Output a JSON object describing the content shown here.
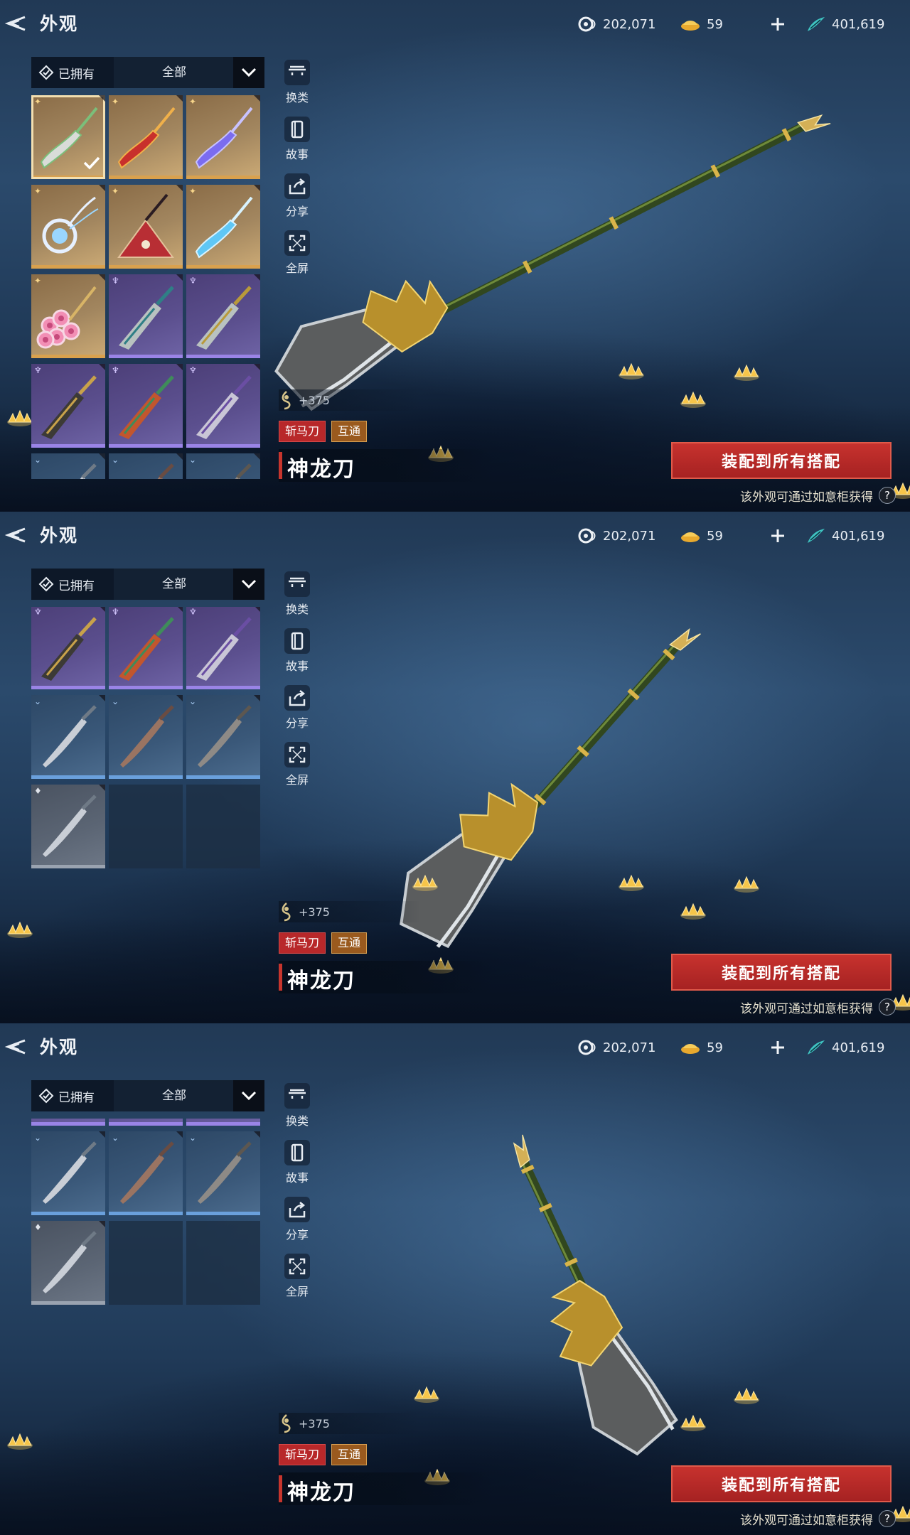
{
  "screens": [
    {
      "header": {
        "title": "外观"
      },
      "currencies": {
        "jade": "202,071",
        "ingot": "59",
        "coins": "401,619"
      },
      "filter": {
        "owned_label": "已拥有",
        "category": "全部"
      },
      "actions": {
        "swap": "换类",
        "story": "故事",
        "share": "分享",
        "fullscreen": "全屏"
      },
      "weapon": {
        "power": "+375",
        "tag_type": "斩马刀",
        "tag_share": "互通",
        "name": "神龙刀",
        "equip_label": "装配到所有搭配",
        "source_text": "该外观可通过如意柜获得"
      }
    },
    {
      "header": {
        "title": "外观"
      },
      "currencies": {
        "jade": "202,071",
        "ingot": "59",
        "coins": "401,619"
      },
      "filter": {
        "owned_label": "已拥有",
        "category": "全部"
      },
      "actions": {
        "swap": "换类",
        "story": "故事",
        "share": "分享",
        "fullscreen": "全屏"
      },
      "weapon": {
        "power": "+375",
        "tag_type": "斩马刀",
        "tag_share": "互通",
        "name": "神龙刀",
        "equip_label": "装配到所有搭配",
        "source_text": "该外观可通过如意柜获得"
      }
    },
    {
      "header": {
        "title": "外观"
      },
      "currencies": {
        "jade": "202,071",
        "ingot": "59",
        "coins": "401,619"
      },
      "filter": {
        "owned_label": "已拥有",
        "category": "全部"
      },
      "actions": {
        "swap": "换类",
        "story": "故事",
        "share": "分享",
        "fullscreen": "全屏"
      },
      "weapon": {
        "power": "+375",
        "tag_type": "斩马刀",
        "tag_share": "互通",
        "name": "神龙刀",
        "equip_label": "装配到所有搭配",
        "source_text": "该外观可通过如意柜获得"
      }
    }
  ],
  "help_glyph": "?",
  "grid": {
    "selected_index": 0,
    "tiles": [
      {
        "rarity": "gold",
        "kind": "glaive",
        "color": "#d9dcd8",
        "accent": "#7bbf7a"
      },
      {
        "rarity": "gold",
        "kind": "glaive",
        "color": "#c8302c",
        "accent": "#f0b04a"
      },
      {
        "rarity": "gold",
        "kind": "glaive",
        "color": "#7b6cf0",
        "accent": "#c8c2ff"
      },
      {
        "rarity": "gold",
        "kind": "orb",
        "color": "#9ad6ff",
        "accent": "#e6f0ff"
      },
      {
        "rarity": "gold",
        "kind": "shield",
        "color": "#b82e34",
        "accent": "#2a1c22"
      },
      {
        "rarity": "gold",
        "kind": "glaive",
        "color": "#5fc7f5",
        "accent": "#d8f3ff"
      },
      {
        "rarity": "gold",
        "kind": "flower",
        "color": "#f28fb5",
        "accent": "#f7d7e4"
      },
      {
        "rarity": "purple",
        "kind": "blade",
        "color": "#b9c2c0",
        "accent": "#2f7f86"
      },
      {
        "rarity": "purple",
        "kind": "blade",
        "color": "#b9c2c0",
        "accent": "#b99a3a"
      },
      {
        "rarity": "purple",
        "kind": "blade",
        "color": "#3c3a36",
        "accent": "#c8a24a"
      },
      {
        "rarity": "purple",
        "kind": "blade",
        "color": "#c2562e",
        "accent": "#3f8c5a"
      },
      {
        "rarity": "purple",
        "kind": "blade",
        "color": "#c9c6d6",
        "accent": "#6a4ea3"
      },
      {
        "rarity": "blue",
        "kind": "sabre",
        "color": "#c9ced6",
        "accent": "#6f7a86"
      },
      {
        "rarity": "blue",
        "kind": "sabre",
        "color": "#9a7462",
        "accent": "#6a4c42"
      },
      {
        "rarity": "blue",
        "kind": "sabre",
        "color": "#8e8a86",
        "accent": "#5d5750"
      },
      {
        "rarity": "gray",
        "kind": "sabre",
        "color": "#c9ced6",
        "accent": "#6f7a86"
      },
      {
        "rarity": "empty"
      },
      {
        "rarity": "empty"
      }
    ]
  },
  "colors": {
    "accent_red": "#c7322e",
    "gold_frame": "#d9a14e",
    "purple_frame": "#9a84e6",
    "blue_frame": "#6aa0dc"
  }
}
